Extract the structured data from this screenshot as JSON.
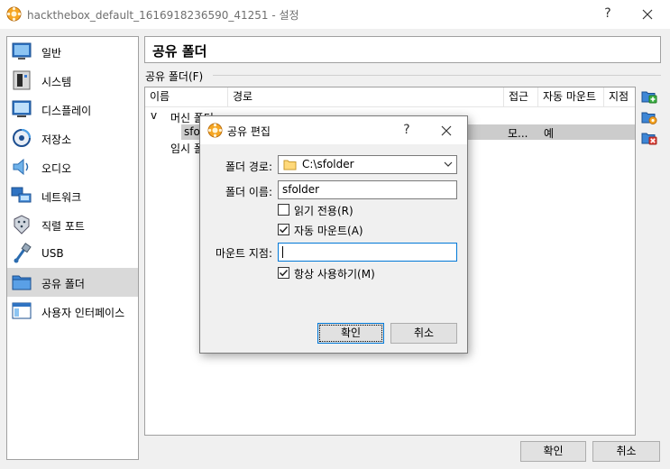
{
  "window": {
    "title": "hackthebox_default_1616918236590_41251 - 설정",
    "help_glyph": "?"
  },
  "sidebar": {
    "items": [
      {
        "label": "일반",
        "icon": "general-icon"
      },
      {
        "label": "시스템",
        "icon": "system-icon"
      },
      {
        "label": "디스플레이",
        "icon": "display-icon"
      },
      {
        "label": "저장소",
        "icon": "storage-icon"
      },
      {
        "label": "오디오",
        "icon": "audio-icon"
      },
      {
        "label": "네트워크",
        "icon": "network-icon"
      },
      {
        "label": "직렬 포트",
        "icon": "serial-port-icon"
      },
      {
        "label": "USB",
        "icon": "usb-icon"
      },
      {
        "label": "공유 폴더",
        "icon": "shared-folder-icon",
        "selected": true
      },
      {
        "label": "사용자 인터페이스",
        "icon": "user-interface-icon"
      }
    ]
  },
  "page": {
    "title": "공유 폴더",
    "group_label": "공유 폴더(F)"
  },
  "table": {
    "columns": [
      "이름",
      "경로",
      "접근",
      "자동 마운트",
      "지점"
    ],
    "machine_folders": "머신 폴더",
    "row_name": "sfo",
    "row_access": "모...",
    "row_auto": "예",
    "temp_folders": "임시 폴",
    "expand_glyph": "v"
  },
  "dialog": {
    "title": "공유 편집",
    "help_glyph": "?",
    "path_label": "폴더 경로:",
    "path_value": "C:\\sfolder",
    "name_label": "폴더 이름:",
    "name_value": "sfolder",
    "readonly_label": "읽기 전용(R)",
    "readonly_checked": false,
    "automount_label": "자동 마운트(A)",
    "automount_checked": true,
    "mountpoint_label": "마운트 지점:",
    "mountpoint_value": "",
    "permanent_label": "항상 사용하기(M)",
    "permanent_checked": true,
    "ok_label": "확인",
    "cancel_label": "취소"
  },
  "footer": {
    "ok_label": "확인",
    "cancel_label": "취소"
  },
  "colors": {
    "selection": "#d9d9d9",
    "focus_blue": "#0078d7",
    "folder_yellow": "#ffd97a"
  }
}
